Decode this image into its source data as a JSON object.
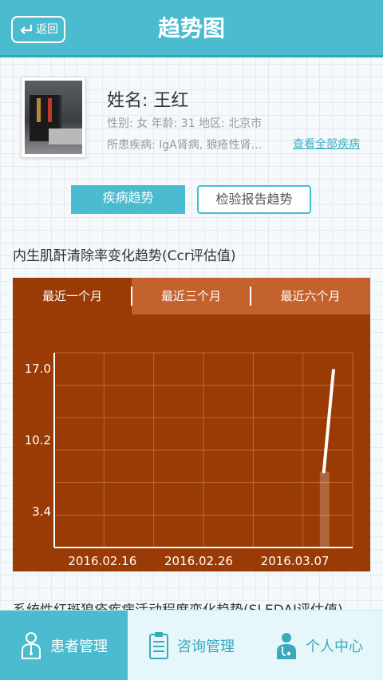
{
  "header": {
    "back_label": "返回",
    "title": "趋势图"
  },
  "patient": {
    "name_line": "姓名: 王红",
    "info_line": "性别: 女   年龄: 31   地区: 北京市",
    "disease_line": "所患疾病: IgA肾病, 狼疮性肾...",
    "view_all_label": "查看全部疾病"
  },
  "trend_tabs": [
    {
      "label": "疾病趋势",
      "active": true
    },
    {
      "label": "检验报告趋势",
      "active": false
    }
  ],
  "section_title": "内生肌酐清除率变化趋势(Ccr评估值)",
  "period_tabs": [
    {
      "label": "最近一个月",
      "active": true
    },
    {
      "label": "最近三个月"
    },
    {
      "label": "最近六个月"
    }
  ],
  "chart_data": {
    "type": "line",
    "x_ticks": [
      "2016.02.16",
      "2016.02.26",
      "2016.03.07"
    ],
    "y_ticks": [
      "17.0",
      "10.2",
      "3.4"
    ],
    "ylim": [
      0,
      18.5
    ],
    "grid": true,
    "series": [
      {
        "points": [
          {
            "x": "2016.03.10",
            "y": 7.2
          },
          {
            "x": "2016.03.11",
            "y": 16.8
          }
        ]
      }
    ]
  },
  "next_section_title": "系统性红斑狼疮疾病活动程度变化趋势(SLEDAI评估值)",
  "bottom_nav": [
    {
      "label": "患者管理",
      "icon": "patient-icon",
      "active": true
    },
    {
      "label": "咨询管理",
      "icon": "clipboard-icon",
      "active": false
    },
    {
      "label": "个人中心",
      "icon": "doctor-icon",
      "active": false
    }
  ],
  "colors": {
    "accent": "#4bbccf",
    "chart_bg": "#9a3a05",
    "tab_bg": "#c4622e"
  }
}
